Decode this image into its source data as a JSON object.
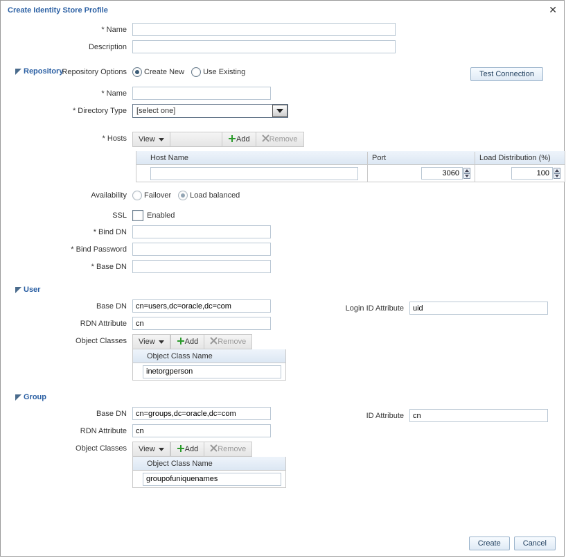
{
  "dialog": {
    "title": "Create Identity Store Profile"
  },
  "header_fields": {
    "name_label": "Name",
    "description_label": "Description",
    "name_value": "",
    "description_value": ""
  },
  "repository": {
    "section_title": "Repository",
    "options_label": "Repository Options",
    "create_new_label": "Create New",
    "use_existing_label": "Use Existing",
    "test_connection_label": "Test Connection",
    "name_label": "Name",
    "name_value": "",
    "dir_type_label": "Directory Type",
    "dir_type_value": "[select one]",
    "hosts_label": "Hosts",
    "toolbar_view": "View",
    "toolbar_add": "Add",
    "toolbar_remove": "Remove",
    "hosts_columns": {
      "host": "Host Name",
      "port": "Port",
      "load": "Load Distribution (%)"
    },
    "hosts_row": {
      "host": "",
      "port": "3060",
      "load": "100"
    },
    "availability_label": "Availability",
    "failover_label": "Failover",
    "load_balanced_label": "Load balanced",
    "ssl_label": "SSL",
    "ssl_enabled_label": "Enabled",
    "bind_dn_label": "Bind DN",
    "bind_dn_value": "",
    "bind_pw_label": "Bind Password",
    "bind_pw_value": "",
    "base_dn_label": "Base DN",
    "base_dn_value": ""
  },
  "user": {
    "section_title": "User",
    "base_dn_label": "Base DN",
    "base_dn_value": "cn=users,dc=oracle,dc=com",
    "rdn_label": "RDN Attribute",
    "rdn_value": "cn",
    "login_id_label": "Login ID Attribute",
    "login_id_value": "uid",
    "oc_label": "Object Classes",
    "toolbar_view": "View",
    "toolbar_add": "Add",
    "toolbar_remove": "Remove",
    "oc_column": "Object Class Name",
    "oc_value": "inetorgperson"
  },
  "group": {
    "section_title": "Group",
    "base_dn_label": "Base DN",
    "base_dn_value": "cn=groups,dc=oracle,dc=com",
    "rdn_label": "RDN Attribute",
    "rdn_value": "cn",
    "id_attr_label": "ID Attribute",
    "id_attr_value": "cn",
    "oc_label": "Object Classes",
    "toolbar_view": "View",
    "toolbar_add": "Add",
    "toolbar_remove": "Remove",
    "oc_column": "Object Class Name",
    "oc_value": "groupofuniquenames"
  },
  "footer": {
    "create_label": "Create",
    "cancel_label": "Cancel"
  }
}
